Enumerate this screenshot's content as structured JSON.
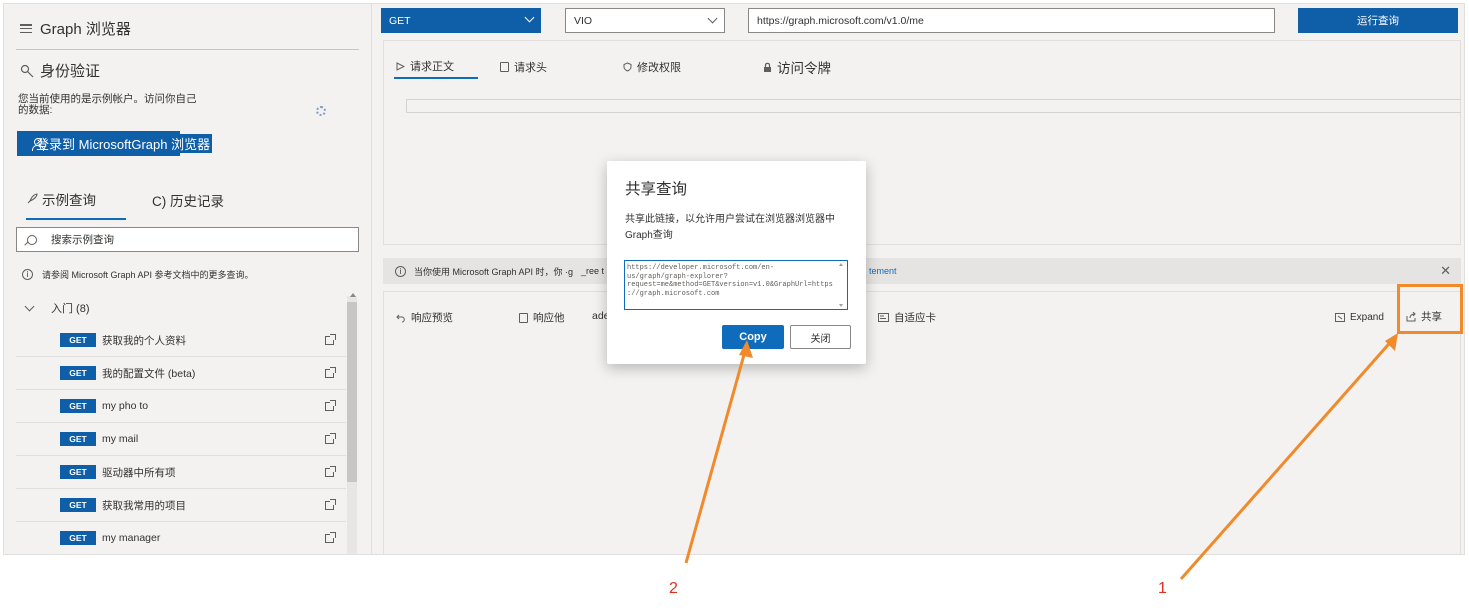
{
  "sidebar": {
    "app_title": "Graph 浏览器",
    "auth_title": "身份验证",
    "auth_desc": "您当前使用的是示例帐户。访问你自己的数据:",
    "signin_label": "登录到 MicrosoftGraph 浏览器",
    "tabs": [
      {
        "label": "示例查询",
        "icon": "rocket-icon"
      },
      {
        "label": "C) 历史记录",
        "icon": ""
      }
    ],
    "search_placeholder": "搜索示例查询",
    "info_text": "请参阅 Microsoft Graph API 参考文档中的更多查询。",
    "group_label": "入门 (8)",
    "samples": [
      {
        "method": "GET",
        "label": "获取我的个人资料"
      },
      {
        "method": "GET",
        "label": "我的配置文件 (beta)"
      },
      {
        "method": "GET",
        "label": "my pho  to"
      },
      {
        "method": "GET",
        "label": "my mail"
      },
      {
        "method": "GET",
        "label": "驱动器中所有项"
      },
      {
        "method": "GET",
        "label": "获取我常用的项目"
      },
      {
        "method": "GET",
        "label": "my manager"
      }
    ]
  },
  "query_bar": {
    "method": "GET",
    "version": "VIO",
    "url": "https://graph.microsoft.com/v1.0/me",
    "run_label": "运行查询"
  },
  "request_tabs": [
    {
      "label": "请求正文",
      "icon": "play-icon"
    },
    {
      "label": "请求头",
      "icon": "document-icon"
    },
    {
      "label": "修改权限",
      "icon": "shield-icon"
    },
    {
      "label": "访问令牌",
      "icon": "lock-icon"
    }
  ],
  "banner": {
    "text": "当你使用 Microsoft Graph API 时，你 ·g",
    "text_tail": "_ree t",
    "link": "tement"
  },
  "response_tabs": {
    "preview": "响应预览",
    "headers": "响应他",
    "partial": "ade",
    "adaptive": "自适应卡",
    "expand": "Expand",
    "share": "共享"
  },
  "dialog": {
    "title": "共享查询",
    "description": "共享此链接，以允许用户尝试在浏览器浏览器中 Graph查询",
    "link": "https://developer.microsoft.com/en-us/graph/graph-explorer?request=me&method=GET&version=v1.0&GraphUrl=https://graph.microsoft.com",
    "copy_label": "Copy",
    "close_label": "关闭"
  },
  "annotations": {
    "label_1": "1",
    "label_2": "2",
    "arrow_color": "#f08a2b",
    "number_color": "#e0301e"
  },
  "colors": {
    "accent": "#0f5ea8",
    "highlight": "#f08a2b"
  }
}
